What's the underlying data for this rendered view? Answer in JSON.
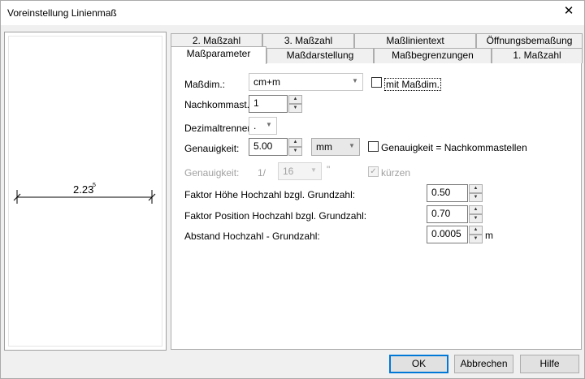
{
  "window": {
    "title": "Voreinstellung Linienmaß",
    "close_glyph": "✕"
  },
  "preview": {
    "dimension_text": "2.23",
    "superscript": "5"
  },
  "tabs_back": [
    "2. Maßzahl",
    "3. Maßzahl",
    "Maßlinientext",
    "Öffnungsbemaßung"
  ],
  "tabs_front": [
    "Maßparameter",
    "Maßdarstellung",
    "Maßbegrenzungen",
    "1. Maßzahl"
  ],
  "active_tab": "Maßparameter",
  "form": {
    "massdim": {
      "label": "Maßdim.:",
      "value": "cm+m",
      "checkbox_label": "mit Maßdim.",
      "checked": false
    },
    "nachkommast": {
      "label": "Nachkommast.:",
      "value": "1"
    },
    "dezimaltrenner": {
      "label": "Dezimaltrenner:",
      "value": "."
    },
    "genauigkeit": {
      "label": "Genauigkeit:",
      "value": "5.00",
      "unit": "mm",
      "checkbox_label": "Genauigkeit = Nachkommastellen",
      "checked": false
    },
    "genauigkeit_frac": {
      "label": "Genauigkeit:",
      "prefix": "1/",
      "value": "16",
      "unit": "\"",
      "checkbox_label": "kürzen",
      "checked": true,
      "disabled": true
    },
    "faktor_hoehe": {
      "label": "Faktor Höhe Hochzahl bzgl. Grundzahl:",
      "value": "0.50"
    },
    "faktor_position": {
      "label": "Faktor Position Hochzahl bzgl. Grundzahl:",
      "value": "0.70"
    },
    "abstand": {
      "label": "Abstand Hochzahl - Grundzahl:",
      "value": "0.0005",
      "unit": "m"
    }
  },
  "buttons": {
    "ok": "OK",
    "cancel": "Abbrechen",
    "help": "Hilfe"
  },
  "colors": {
    "accent": "#0078d7",
    "border": "#adadad",
    "disabled_text": "#a0a0a0"
  },
  "icons": {
    "spin_up": "▲",
    "spin_down": "▼",
    "dropdown": "▼",
    "check": "✓"
  }
}
